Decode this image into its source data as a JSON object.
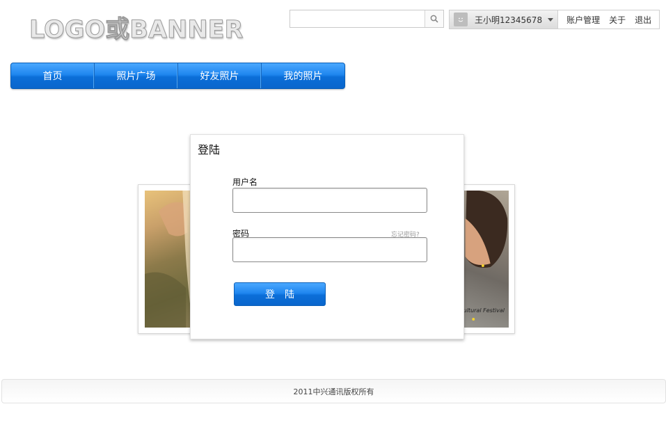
{
  "logo": {
    "text": "LOGO或BANNER"
  },
  "search": {
    "placeholder": "",
    "value": "",
    "icon": "search-icon"
  },
  "userbar": {
    "avatar_icon": "smiley-icon",
    "username": "王小明12345678",
    "links": [
      "账户管理",
      "关于",
      "退出"
    ]
  },
  "nav": {
    "items": [
      "首页",
      "照片广场",
      "好友照片",
      "我的照片"
    ]
  },
  "photos": {
    "right_caption": "Cultural Festival"
  },
  "login": {
    "title": "登陆",
    "username_label": "用户名",
    "username_value": "",
    "password_label": "密码",
    "password_value": "",
    "forgot_label": "忘记密码?",
    "submit_label": "登陆"
  },
  "footer": {
    "text": "2011中兴通讯版权所有"
  },
  "colors": {
    "accent": "#1a7fe8",
    "accent_dark": "#0a5fb8"
  }
}
